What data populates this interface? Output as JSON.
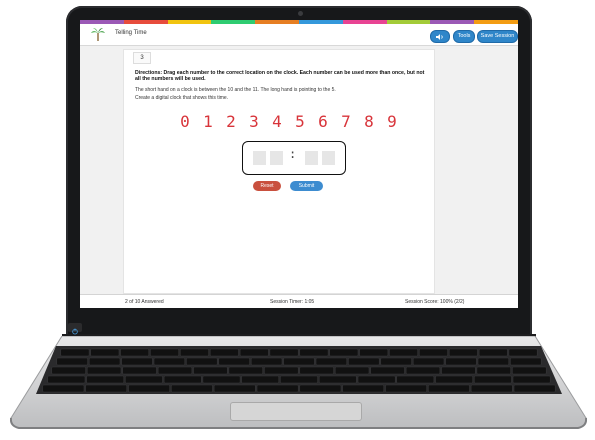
{
  "app": {
    "title": "Telling Time"
  },
  "header": {
    "audio_icon": "speaker-icon",
    "tools_label": "Tools",
    "save_label": "Save Session"
  },
  "question": {
    "number": "3",
    "directions": "Directions: Drag each number to the correct location on the clock. Each number can be used more than once, but not all the numbers will be used.",
    "line1": "The short hand on a clock is between the 10 and the 11. The long hand is pointing to the 5.",
    "line2": "Create a digital clock that shows this time.",
    "digits": [
      "0",
      "1",
      "2",
      "3",
      "4",
      "5",
      "6",
      "7",
      "8",
      "9"
    ],
    "colon": ":",
    "reset_label": "Reset",
    "submit_label": "Submit"
  },
  "status": {
    "answered": "2 of 10 Answered",
    "timer": "Session Timer: 1:05",
    "score": "Session Score: 100% (2/2)"
  },
  "colors": {
    "digit": "#d8343a",
    "primary": "#2f86c9",
    "reset": "#c9503e",
    "rainbow": [
      "#9b59b6",
      "#e74c3c",
      "#f1c40f",
      "#2ecc71",
      "#e67e22",
      "#3498db",
      "#e84393",
      "#a3cb38",
      "#9b59b6",
      "#f39c12"
    ]
  }
}
